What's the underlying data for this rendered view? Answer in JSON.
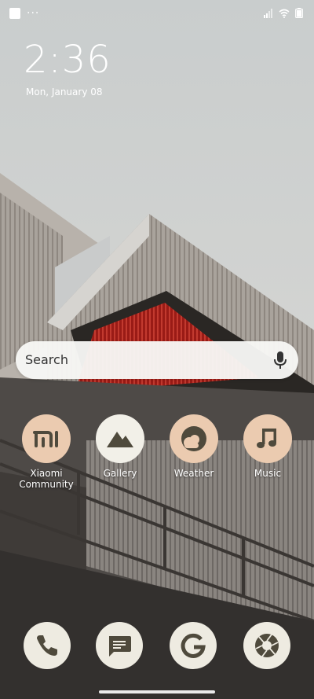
{
  "status_bar": {
    "dots": "···"
  },
  "lock": {
    "time": "2:36",
    "date": "Mon, January 08"
  },
  "search": {
    "placeholder": "Search"
  },
  "apps": [
    {
      "label": "Xiaomi\nCommunity",
      "icon": "xiaomi-mi-icon"
    },
    {
      "label": "Gallery",
      "icon": "mountain-icon"
    },
    {
      "label": "Weather",
      "icon": "sun-cloud-icon"
    },
    {
      "label": "Music",
      "icon": "music-note-icon"
    }
  ],
  "dock": [
    {
      "icon": "phone-icon"
    },
    {
      "icon": "message-icon"
    },
    {
      "icon": "google-icon"
    },
    {
      "icon": "camera-aperture-icon"
    }
  ],
  "colors": {
    "icon_peach": "#EBCBB0",
    "icon_cream": "#F2F0E8",
    "icon_glyph": "#4F4A3C"
  }
}
